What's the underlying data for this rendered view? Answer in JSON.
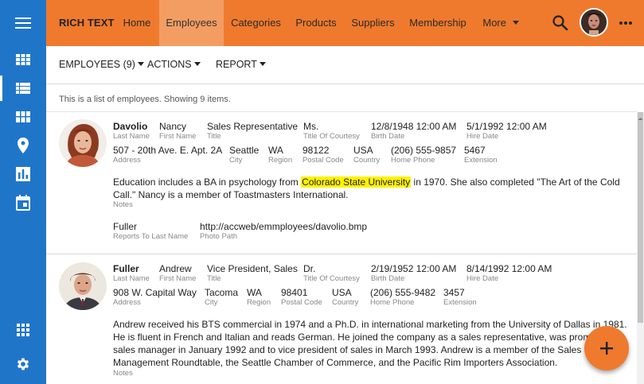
{
  "app": {
    "brand": "RICH TEXT",
    "nav": [
      {
        "label": "Home"
      },
      {
        "label": "Employees"
      },
      {
        "label": "Categories"
      },
      {
        "label": "Products"
      },
      {
        "label": "Suppliers"
      },
      {
        "label": "Membership"
      },
      {
        "label": "More"
      }
    ],
    "active_nav": "Employees"
  },
  "rail": {
    "icons": [
      "menu-icon",
      "grid-icon",
      "list-icon",
      "tiles-icon",
      "map-pin-icon",
      "bar-chart-icon",
      "calendar-icon",
      "apps-icon",
      "settings-icon"
    ],
    "active": "list-icon"
  },
  "toolbar": {
    "employees_label": "EMPLOYEES (9)",
    "actions_label": "ACTIONS",
    "report_label": "REPORT"
  },
  "info_text": "This is a list of employees. Showing 9 items.",
  "labels": {
    "last_name": "Last Name",
    "first_name": "First Name",
    "title": "Title",
    "title_of_courtesy": "Title Of Courtesy",
    "birth_date": "Birth Date",
    "hire_date": "Hire Date",
    "address": "Address",
    "city": "City",
    "region": "Region",
    "postal_code": "Postal Code",
    "country": "Country",
    "home_phone": "Home Phone",
    "extension": "Extension",
    "notes": "Notes",
    "reports_to": "Reports To Last Name",
    "photo_path": "Photo Path"
  },
  "employees": [
    {
      "last_name": "Davolio",
      "first_name": "Nancy",
      "title": "Sales Representative",
      "title_of_courtesy": "Ms.",
      "birth_date": "12/8/1948 12:00 AM",
      "hire_date": "5/1/1992 12:00 AM",
      "address": "507 - 20th Ave. E. Apt. 2A",
      "city": "Seattle",
      "region": "WA",
      "postal_code": "98122",
      "country": "USA",
      "home_phone": "(206) 555-9857",
      "extension": "5467",
      "notes_before": "Education includes a BA in psychology from ",
      "notes_highlight": "Colorado State University",
      "notes_after_line1": " in 1970. She also completed \"The Art of the Cold",
      "notes_line2": "Call.\" Nancy is a member of Toastmasters International.",
      "reports_to": "Fuller",
      "photo_path": "http://accweb/emmployees/davolio.bmp"
    },
    {
      "last_name": "Fuller",
      "first_name": "Andrew",
      "title": "Vice President, Sales",
      "title_of_courtesy": "Dr.",
      "birth_date": "2/19/1952 12:00 AM",
      "hire_date": "8/14/1992 12:00 AM",
      "address": "908 W. Capital Way",
      "city": "Tacoma",
      "region": "WA",
      "postal_code": "98401",
      "country": "USA",
      "home_phone": "(206) 555-9482",
      "extension": "3457",
      "notes_lines": [
        "Andrew received his BTS commercial in 1974 and a Ph.D. in international marketing from the University of Dallas in 1981.",
        "He is fluent in French and Italian and reads German. He joined the company as a sales representative, was promoted to",
        "sales manager in January 1992 and to vice president of sales in March 1993. Andrew is a member of the Sales",
        "Management Roundtable, the Seattle Chamber of Commerce, and the Pacific Rim Importers Association."
      ]
    }
  ],
  "colors": {
    "rail": "#1f76c8",
    "topbar": "#ef7a2d",
    "active_tab": "#f39d63",
    "highlight": "#fff200",
    "fab": "#ef7a2d"
  },
  "fab_icon": "plus-icon"
}
